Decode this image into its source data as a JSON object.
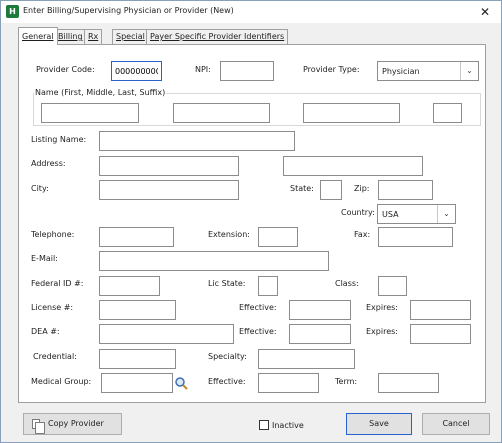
{
  "window": {
    "title": "Enter Billing/Supervising Physician or Provider  (New)",
    "app_icon": "H",
    "close_glyph": "✕"
  },
  "tabs": [
    {
      "label": "General",
      "active": true
    },
    {
      "label": "Billing",
      "active": false
    },
    {
      "label": "Rx",
      "active": false
    },
    {
      "label": "Special",
      "active": false
    },
    {
      "label": "Payer Specific Provider Identifiers",
      "active": false
    }
  ],
  "form": {
    "provider_code": {
      "label": "Provider Code:",
      "value": "0000000007"
    },
    "npi": {
      "label": "NPI:",
      "value": ""
    },
    "provider_type": {
      "label": "Provider Type:",
      "value": "Physician"
    },
    "name_group_label": "Name (First, Middle, Last, Suffix)",
    "listing_name": {
      "label": "Listing Name:"
    },
    "address": {
      "label": "Address:"
    },
    "city": {
      "label": "City:"
    },
    "state": {
      "label": "State:"
    },
    "zip": {
      "label": "Zip:"
    },
    "country": {
      "label": "Country:",
      "value": "USA"
    },
    "telephone": {
      "label": "Telephone:"
    },
    "extension": {
      "label": "Extension:"
    },
    "fax": {
      "label": "Fax:"
    },
    "email": {
      "label": "E-Mail:"
    },
    "federal_id": {
      "label": "Federal ID #:"
    },
    "lic_state": {
      "label": "Lic State:"
    },
    "class": {
      "label": "Class:"
    },
    "license": {
      "label": "License #:"
    },
    "license_effective": {
      "label": "Effective:"
    },
    "license_expires": {
      "label": "Expires:"
    },
    "dea": {
      "label": "DEA #:"
    },
    "dea_effective": {
      "label": "Effective:"
    },
    "dea_expires": {
      "label": "Expires:"
    },
    "credential": {
      "label": "Credential:"
    },
    "specialty": {
      "label": "Specialty:"
    },
    "medical_group": {
      "label": "Medical Group:"
    },
    "mg_effective": {
      "label": "Effective:"
    },
    "term": {
      "label": "Term:"
    }
  },
  "footer": {
    "copy_provider": "Copy Provider",
    "inactive": "Inactive",
    "save": "Save",
    "cancel": "Cancel"
  },
  "colors": {
    "focus": "#2a62c9",
    "app_icon": "#1e7a3c"
  },
  "icons": [
    "copy-icon",
    "magnifier-icon",
    "chevron-down-icon",
    "close-icon"
  ]
}
